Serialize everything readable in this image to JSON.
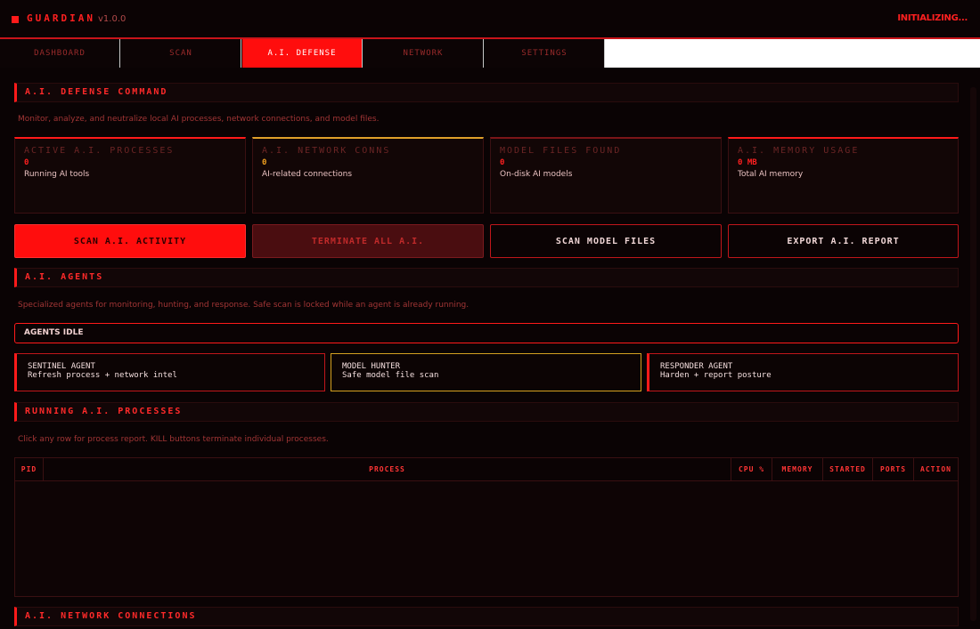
{
  "app": {
    "name": "GUARDIAN",
    "version": "v1.0.0",
    "status": "INITIALIZING..."
  },
  "tabs": [
    {
      "label": "DASHBOARD",
      "active": false
    },
    {
      "label": "SCAN",
      "active": false
    },
    {
      "label": "A.I. DEFENSE",
      "active": true
    },
    {
      "label": "NETWORK",
      "active": false
    },
    {
      "label": "SETTINGS",
      "active": false
    }
  ],
  "defense": {
    "title": "A.I. DEFENSE COMMAND",
    "description": "Monitor, analyze, and neutralize local AI processes, network connections, and model files.",
    "stats": [
      {
        "label": "ACTIVE A.I. PROCESSES",
        "value": "0",
        "sub": "Running AI tools"
      },
      {
        "label": "A.I. NETWORK CONNS",
        "value": "0",
        "sub": "AI-related connections"
      },
      {
        "label": "MODEL FILES FOUND",
        "value": "0",
        "sub": "On-disk AI models"
      },
      {
        "label": "A.I. MEMORY USAGE",
        "value": "0 MB",
        "sub": "Total AI memory"
      }
    ],
    "buttons": {
      "scan": "SCAN A.I. ACTIVITY",
      "terminate": "TERMINATE ALL A.I.",
      "scan_models": "SCAN MODEL FILES",
      "export": "EXPORT A.I. REPORT"
    }
  },
  "agents": {
    "title": "A.I. AGENTS",
    "description": "Specialized agents for monitoring, hunting, and response. Safe scan is locked while an agent is already running.",
    "status": "AGENTS IDLE",
    "items": [
      {
        "name": "SENTINEL AGENT",
        "desc": "Refresh process + network intel"
      },
      {
        "name": "MODEL HUNTER",
        "desc": "Safe model file scan"
      },
      {
        "name": "RESPONDER AGENT",
        "desc": "Harden + report posture"
      }
    ]
  },
  "processes": {
    "title": "RUNNING A.I. PROCESSES",
    "description": "Click any row for process report. KILL buttons terminate individual processes.",
    "columns": [
      "PID",
      "PROCESS",
      "CPU %",
      "MEMORY",
      "STARTED",
      "PORTS",
      "ACTION"
    ],
    "rows": []
  },
  "connections": {
    "title": "A.I. NETWORK CONNECTIONS"
  },
  "colors": {
    "accent": "#ff1a1a",
    "background": "#0a0304",
    "amber": "#e0a02a"
  }
}
